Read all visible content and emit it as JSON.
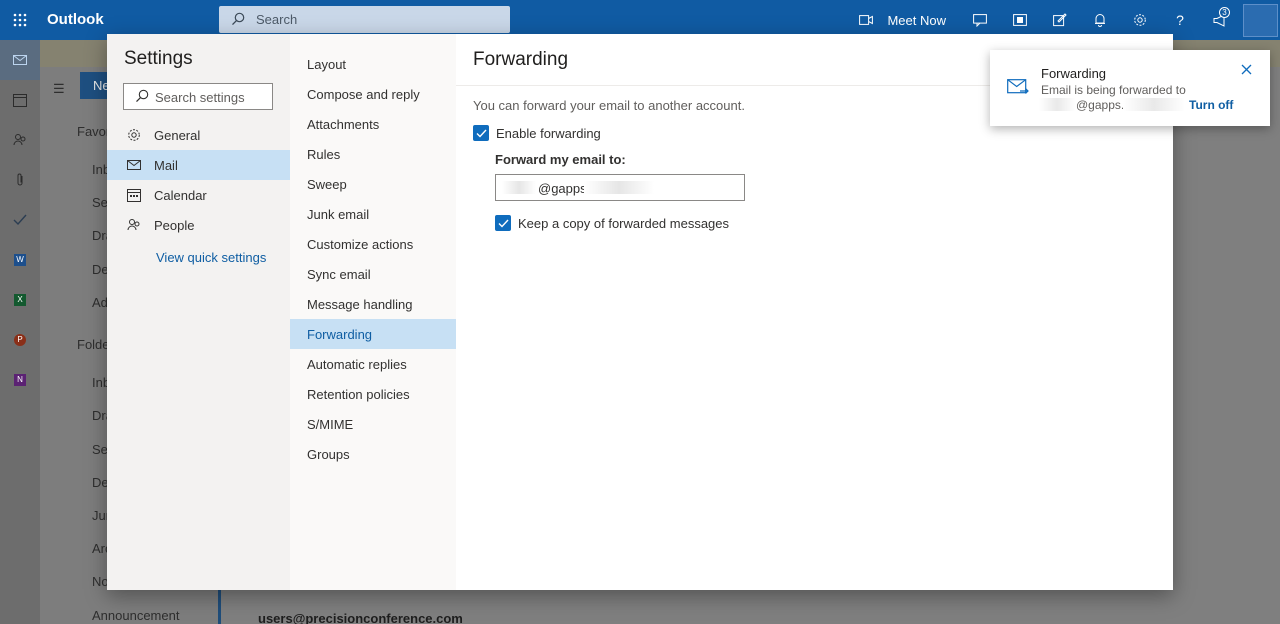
{
  "app": {
    "brand": "Outlook",
    "search_placeholder": "Search",
    "meet_now": "Meet Now",
    "notification_count": "3"
  },
  "background": {
    "new_button": "Ne",
    "folders": [
      "Favor",
      "Inb",
      "Ser",
      "Dra",
      "De",
      "Add",
      "Folde",
      "Inb",
      "Dra",
      "Ser",
      "De",
      "Jun",
      "Arc",
      "No",
      "Announcement"
    ],
    "message_sender": "users@precisionconference.com"
  },
  "settings": {
    "title": "Settings",
    "search_placeholder": "Search settings",
    "categories": [
      {
        "label": "General",
        "icon": "gear-icon"
      },
      {
        "label": "Mail",
        "icon": "mail-icon"
      },
      {
        "label": "Calendar",
        "icon": "calendar-icon"
      },
      {
        "label": "People",
        "icon": "people-icon"
      }
    ],
    "quick_settings": "View quick settings",
    "mail_sections": [
      "Layout",
      "Compose and reply",
      "Attachments",
      "Rules",
      "Sweep",
      "Junk email",
      "Customize actions",
      "Sync email",
      "Message handling",
      "Forwarding",
      "Automatic replies",
      "Retention policies",
      "S/MIME",
      "Groups"
    ],
    "selected_section": "Forwarding"
  },
  "forwarding": {
    "heading": "Forwarding",
    "description": "You can forward your email to another account.",
    "enable_label": "Enable forwarding",
    "enable_checked": true,
    "forward_to_label": "Forward my email to:",
    "forward_to_value": "@gapps.",
    "keep_copy_label": "Keep a copy of forwarded messages",
    "keep_copy_checked": true
  },
  "toast": {
    "title": "Forwarding",
    "line1": "Email is being forwarded to",
    "line2": "@gapps.",
    "action": "Turn off"
  },
  "colors": {
    "accent": "#0f6cbd",
    "topbar": "#105ba3",
    "selected_bg": "#c7e0f4",
    "link": "#0f5ea3"
  }
}
